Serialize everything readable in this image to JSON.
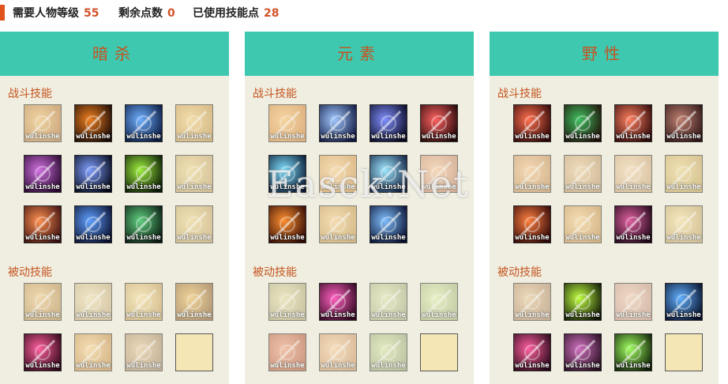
{
  "stats": {
    "required_level_label": "需要人物等级",
    "required_level": "55",
    "remaining_points_label": "剩余点数",
    "remaining_points": "0",
    "used_points_label": "已使用技能点",
    "used_points": "28"
  },
  "colors": {
    "accent": "#e0531c",
    "header": "#3ec8b0",
    "panel": "#f0eee0",
    "label": "#c4541f"
  },
  "watermark": "Easck.Net",
  "panels": [
    {
      "title": "暗杀",
      "combat_label": "战斗技能",
      "passive_label": "被动技能",
      "combat": [
        {
          "icon": "crossbow-shot-icon",
          "wm": "wulinshe",
          "faded": true,
          "colors": [
            "#f0c070",
            "#b07030"
          ]
        },
        {
          "icon": "fire-dash-icon",
          "wm": "wulinshe",
          "faded": false,
          "colors": [
            "#f08020",
            "#1a0a05"
          ]
        },
        {
          "icon": "shadow-strike-icon",
          "wm": "wulinshe",
          "faded": false,
          "colors": [
            "#6fb0ff",
            "#0a1a40"
          ]
        },
        {
          "icon": "slash-icon",
          "wm": "wulinshe",
          "faded": true,
          "colors": [
            "#f5d080",
            "#c09040"
          ]
        },
        {
          "icon": "target-mark-icon",
          "wm": "wulinshe",
          "faded": false,
          "colors": [
            "#d070e0",
            "#2a0a30"
          ]
        },
        {
          "icon": "dark-lunge-icon",
          "wm": "wulinshe",
          "faded": false,
          "colors": [
            "#80a0ff",
            "#050818"
          ]
        },
        {
          "icon": "poison-blade-icon",
          "wm": "wulinshe",
          "faded": false,
          "colors": [
            "#a0f040",
            "#0a1a05"
          ]
        },
        {
          "icon": "faded-swirl-icon",
          "wm": "wulinshe",
          "faded": true,
          "colors": [
            "#f0d890",
            "#c0a060"
          ]
        },
        {
          "icon": "dagger-strike-icon",
          "wm": "wulinshe",
          "faded": false,
          "colors": [
            "#ff9050",
            "#3a1010"
          ]
        },
        {
          "icon": "phantom-dash-icon",
          "wm": "wulinshe",
          "faded": false,
          "colors": [
            "#60a0ff",
            "#0a1030"
          ]
        },
        {
          "icon": "assassin-silhouette-icon",
          "wm": "wulinshe",
          "faded": false,
          "colors": [
            "#60d080",
            "#0a1a10"
          ]
        },
        {
          "icon": "blade-arc-icon",
          "wm": "wulinshe",
          "faded": true,
          "colors": [
            "#f0d890",
            "#c0a060"
          ]
        }
      ],
      "passive": [
        {
          "icon": "blade-mastery-icon",
          "wm": "wulinshe",
          "faded": true,
          "colors": [
            "#f0c888",
            "#b08848"
          ]
        },
        {
          "icon": "agility-icon",
          "wm": "wulinshe",
          "faded": true,
          "colors": [
            "#f0e0b0",
            "#c0a878"
          ]
        },
        {
          "icon": "evasion-icon",
          "wm": "wulinshe",
          "faded": true,
          "colors": [
            "#f8e0a0",
            "#c09850"
          ]
        },
        {
          "icon": "stealth-icon",
          "wm": "wulinshe",
          "faded": true,
          "colors": [
            "#f0c060",
            "#805020"
          ]
        },
        {
          "icon": "critical-eye-icon",
          "wm": "wulinshe",
          "faded": false,
          "colors": [
            "#ff60a0",
            "#300818"
          ]
        },
        {
          "icon": "lethal-focus-icon",
          "wm": "wulinshe",
          "faded": true,
          "colors": [
            "#f8d090",
            "#c08840"
          ]
        },
        {
          "icon": "shadow-form-icon",
          "wm": "wulinshe",
          "faded": true,
          "colors": [
            "#e8c898",
            "#a08060"
          ]
        },
        {
          "icon": "empty-slot",
          "wm": "",
          "faded": false,
          "empty": true,
          "colors": [
            "#f5e6b6",
            "#f5e6b6"
          ]
        }
      ]
    },
    {
      "title": "元素",
      "combat_label": "战斗技能",
      "passive_label": "被动技能",
      "combat": [
        {
          "icon": "fire-burst-icon",
          "wm": "wulinshe",
          "faded": true,
          "colors": [
            "#f8c070",
            "#d08030"
          ]
        },
        {
          "icon": "ice-spear-icon",
          "wm": "wulinshe",
          "faded": false,
          "colors": [
            "#a0c8ff",
            "#101840"
          ]
        },
        {
          "icon": "arcane-bolt-icon",
          "wm": "wulinshe",
          "faded": false,
          "colors": [
            "#8090ff",
            "#080820"
          ]
        },
        {
          "icon": "lightning-strike-icon",
          "wm": "wulinshe",
          "faded": false,
          "colors": [
            "#ff6060",
            "#200808"
          ]
        },
        {
          "icon": "frost-slash-icon",
          "wm": "wulinshe",
          "faded": false,
          "colors": [
            "#80e0ff",
            "#081830"
          ]
        },
        {
          "icon": "flame-wave-icon",
          "wm": "wulinshe",
          "faded": true,
          "colors": [
            "#f8d090",
            "#d09040"
          ]
        },
        {
          "icon": "ice-crystal-icon",
          "wm": "wulinshe",
          "faded": false,
          "colors": [
            "#a0e8ff",
            "#102040"
          ]
        },
        {
          "icon": "ember-icon",
          "wm": "wulinshe",
          "faded": true,
          "colors": [
            "#f8c8a0",
            "#c08060"
          ]
        },
        {
          "icon": "fire-lightning-icon",
          "wm": "wulinshe",
          "faded": false,
          "colors": [
            "#ff9030",
            "#300a05"
          ]
        },
        {
          "icon": "meteor-icon",
          "wm": "wulinshe",
          "faded": true,
          "colors": [
            "#f8d090",
            "#c09040"
          ]
        },
        {
          "icon": "storm-icon",
          "wm": "wulinshe",
          "faded": false,
          "colors": [
            "#80c0ff",
            "#081030"
          ]
        }
      ],
      "passive": [
        {
          "icon": "elemental-focus-icon",
          "wm": "wulinshe",
          "faded": true,
          "colors": [
            "#e8e0a8",
            "#a8a070"
          ]
        },
        {
          "icon": "arcane-surge-icon",
          "wm": "wulinshe",
          "faded": false,
          "colors": [
            "#ff60c0",
            "#300820"
          ]
        },
        {
          "icon": "mana-flow-icon",
          "wm": "wulinshe",
          "faded": true,
          "colors": [
            "#e0e8b0",
            "#a0a878"
          ]
        },
        {
          "icon": "element-orb-icon",
          "wm": "wulinshe",
          "faded": true,
          "colors": [
            "#e0f0b0",
            "#a0b078"
          ]
        },
        {
          "icon": "fire-rage-icon",
          "wm": "wulinshe",
          "faded": true,
          "colors": [
            "#f0a080",
            "#b05030"
          ]
        },
        {
          "icon": "radiance-icon",
          "wm": "wulinshe",
          "faded": true,
          "colors": [
            "#f8d0a0",
            "#c89060"
          ]
        },
        {
          "icon": "nature-spirit-icon",
          "wm": "wulinshe",
          "faded": true,
          "colors": [
            "#d8e8a8",
            "#90a070"
          ]
        },
        {
          "icon": "empty-slot",
          "wm": "",
          "faded": false,
          "empty": true,
          "colors": [
            "#f5e6b6",
            "#f5e6b6"
          ]
        }
      ]
    },
    {
      "title": "野性",
      "combat_label": "战斗技能",
      "passive_label": "被动技能",
      "combat": [
        {
          "icon": "spear-thrust-icon",
          "wm": "wulinshe",
          "faded": false,
          "colors": [
            "#ff7050",
            "#300808"
          ]
        },
        {
          "icon": "leaf-blade-icon",
          "wm": "wulinshe",
          "faded": false,
          "colors": [
            "#40c060",
            "#201008"
          ]
        },
        {
          "icon": "arrow-volley-icon",
          "wm": "wulinshe",
          "faded": false,
          "colors": [
            "#ff8060",
            "#300a0a"
          ]
        },
        {
          "icon": "beast-roar-icon",
          "wm": "wulinshe",
          "faded": false,
          "colors": [
            "#c08070",
            "#301818"
          ]
        },
        {
          "icon": "wind-sigil-icon",
          "wm": "wulinshe",
          "faded": true,
          "colors": [
            "#f8c890",
            "#c08850"
          ]
        },
        {
          "icon": "claw-swipe-icon",
          "wm": "wulinshe",
          "faded": true,
          "colors": [
            "#f0d0a0",
            "#b89060"
          ]
        },
        {
          "icon": "wild-leap-icon",
          "wm": "wulinshe",
          "faded": true,
          "colors": [
            "#f8d8b0",
            "#c8a070"
          ]
        },
        {
          "icon": "net-trap-icon",
          "wm": "wulinshe",
          "faded": true,
          "colors": [
            "#f0d890",
            "#c0a050"
          ]
        },
        {
          "icon": "piercing-lance-icon",
          "wm": "wulinshe",
          "faded": false,
          "colors": [
            "#ff8040",
            "#300808"
          ]
        },
        {
          "icon": "hunter-instinct-icon",
          "wm": "wulinshe",
          "faded": true,
          "colors": [
            "#f8d090",
            "#c08840"
          ]
        },
        {
          "icon": "hooded-hunter-icon",
          "wm": "wulinshe",
          "faded": false,
          "colors": [
            "#e060a0",
            "#200818"
          ]
        },
        {
          "icon": "spirit-totem-icon",
          "wm": "wulinshe",
          "faded": true,
          "colors": [
            "#f8e0a0",
            "#c0a060"
          ]
        }
      ],
      "passive": [
        {
          "icon": "bear-form-icon",
          "wm": "wulinshe",
          "faded": true,
          "colors": [
            "#e8c898",
            "#a88060"
          ]
        },
        {
          "icon": "feral-eyes-icon",
          "wm": "wulinshe",
          "faded": false,
          "colors": [
            "#c0ff40",
            "#101808"
          ]
        },
        {
          "icon": "sharp-claw-icon",
          "wm": "wulinshe",
          "faded": true,
          "colors": [
            "#f0c8b0",
            "#c09080"
          ]
        },
        {
          "icon": "eagle-eye-icon",
          "wm": "wulinshe",
          "faded": false,
          "colors": [
            "#60b0ff",
            "#081028"
          ]
        },
        {
          "icon": "longbow-icon",
          "wm": "wulinshe",
          "faded": false,
          "colors": [
            "#ff60a0",
            "#280818"
          ]
        },
        {
          "icon": "wild-spirit-icon",
          "wm": "wulinshe",
          "faded": false,
          "colors": [
            "#d070c0",
            "#281020"
          ]
        },
        {
          "icon": "paw-print-icon",
          "wm": "wulinshe",
          "faded": false,
          "colors": [
            "#a0ff60",
            "#102008"
          ]
        },
        {
          "icon": "empty-slot",
          "wm": "",
          "faded": false,
          "empty": true,
          "colors": [
            "#f5e6b6",
            "#f5e6b6"
          ]
        }
      ]
    }
  ]
}
